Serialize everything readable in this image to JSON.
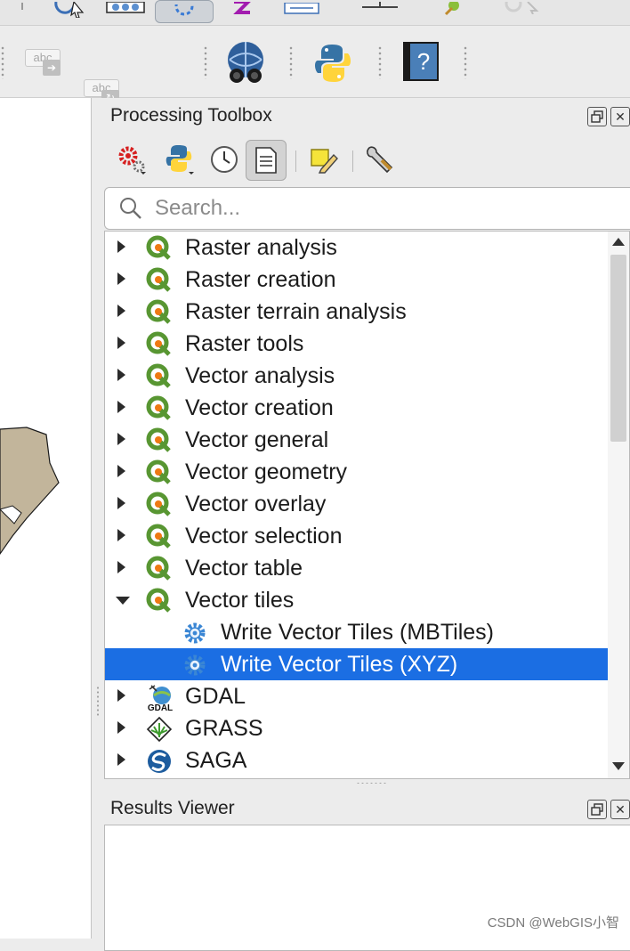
{
  "toolbox": {
    "title": "Processing Toolbox",
    "search_placeholder": "Search...",
    "items": [
      {
        "label": "Raster analysis",
        "icon": "qgis-logo-icon",
        "expanded": false
      },
      {
        "label": "Raster creation",
        "icon": "qgis-logo-icon",
        "expanded": false
      },
      {
        "label": "Raster terrain analysis",
        "icon": "qgis-logo-icon",
        "expanded": false
      },
      {
        "label": "Raster tools",
        "icon": "qgis-logo-icon",
        "expanded": false
      },
      {
        "label": "Vector analysis",
        "icon": "qgis-logo-icon",
        "expanded": false
      },
      {
        "label": "Vector creation",
        "icon": "qgis-logo-icon",
        "expanded": false
      },
      {
        "label": "Vector general",
        "icon": "qgis-logo-icon",
        "expanded": false
      },
      {
        "label": "Vector geometry",
        "icon": "qgis-logo-icon",
        "expanded": false
      },
      {
        "label": "Vector overlay",
        "icon": "qgis-logo-icon",
        "expanded": false
      },
      {
        "label": "Vector selection",
        "icon": "qgis-logo-icon",
        "expanded": false
      },
      {
        "label": "Vector table",
        "icon": "qgis-logo-icon",
        "expanded": false
      },
      {
        "label": "Vector tiles",
        "icon": "qgis-logo-icon",
        "expanded": true
      },
      {
        "label": "Write Vector Tiles (MBTiles)",
        "icon": "gear-icon",
        "child": true
      },
      {
        "label": "Write Vector Tiles (XYZ)",
        "icon": "gear-icon",
        "child": true,
        "selected": true
      },
      {
        "label": "GDAL",
        "icon": "gdal-icon",
        "expanded": false
      },
      {
        "label": "GRASS",
        "icon": "grass-icon",
        "expanded": false
      },
      {
        "label": "SAGA",
        "icon": "saga-icon",
        "expanded": false
      }
    ]
  },
  "toolbar": {
    "abc_label": "abc"
  },
  "results": {
    "title": "Results Viewer"
  },
  "watermark": "CSDN @WebGIS小智",
  "colors": {
    "selection": "#1b6ee3",
    "qgis_green": "#589632",
    "qgis_orange": "#ee7913",
    "map_fill": "#c2b59b"
  }
}
